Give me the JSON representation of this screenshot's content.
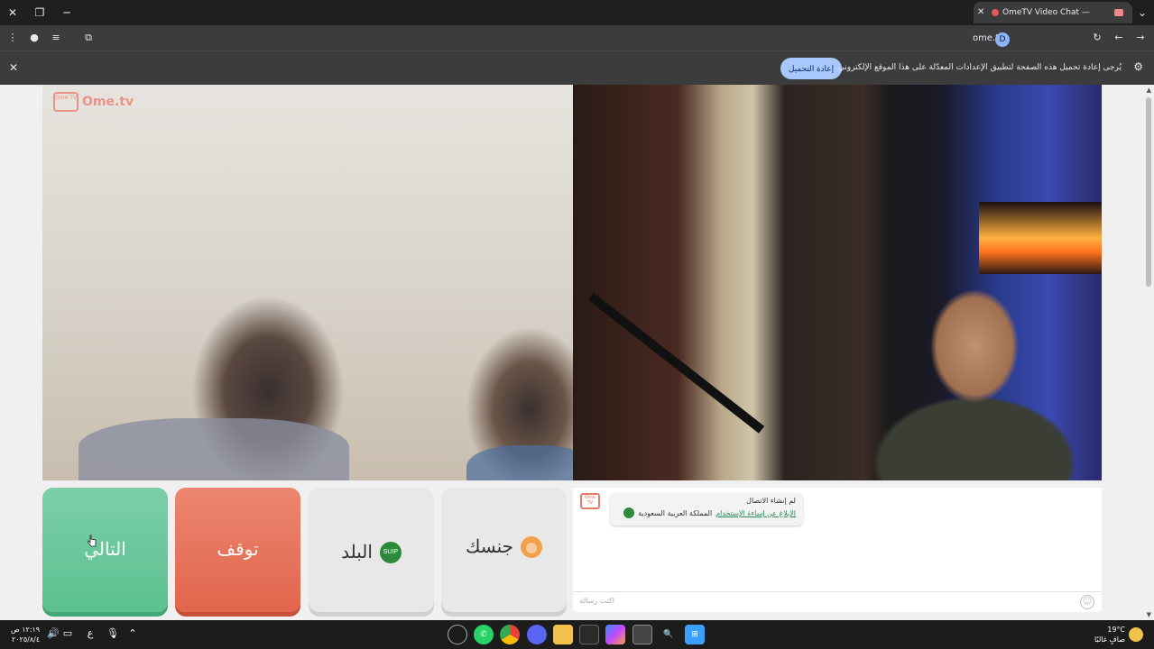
{
  "browser": {
    "tab_title": "OmeTV Video Chat — Ome",
    "url": "ome.tv",
    "profile_initial": "D"
  },
  "infobar": {
    "message": "يُرجى إعادة تحميل هذه الصفحة لتطبيق الإعدادات المعدّلة على هذا الموقع الإلكتروني.",
    "reload_label": "إعادة التحميل"
  },
  "site": {
    "logo_small": "Ome TV",
    "logo_text": "Ome.tv"
  },
  "controls": {
    "next_label": "التالي",
    "stop_label": "توقف",
    "country_label": "البلد",
    "gender_label": "جنسك",
    "country_flag": "SUIP"
  },
  "chat": {
    "logo": "Ome TV",
    "status": "لم إنشاء الاتصال",
    "report_link": "الإبلاغ عن إساءة الإستخدام",
    "country": "المملكة العربية السعودية",
    "input_placeholder": "اكتب رسالة"
  },
  "taskbar": {
    "time": "١٢:١٩ ص",
    "date": "٢٠٢٥/٨/٤",
    "lang": "ع",
    "temperature": "19°C",
    "weather": "صافٍ غالبًا"
  },
  "colors": {
    "next": "#5cc090",
    "stop": "#e2654c",
    "brand": "#e87a6a"
  }
}
